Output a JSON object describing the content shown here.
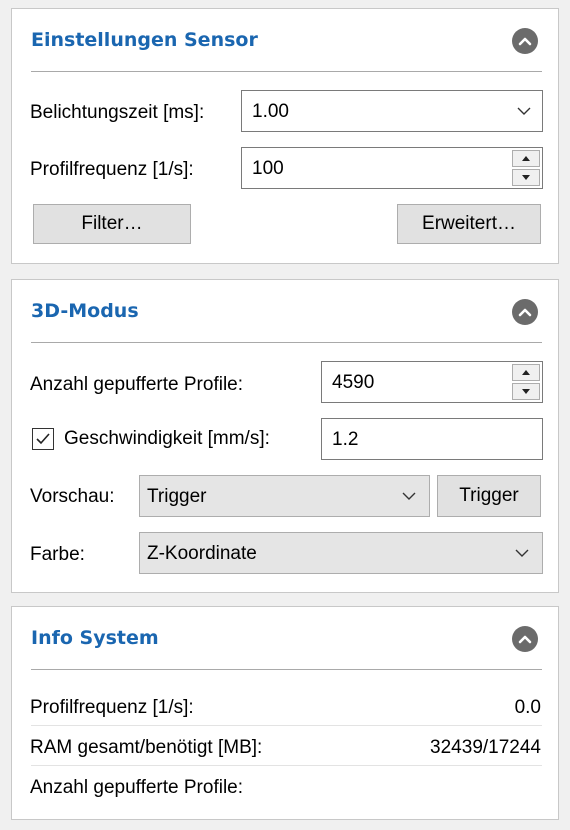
{
  "sensor": {
    "title": "Einstellungen Sensor",
    "exposure_label": "Belichtungszeit [ms]:",
    "exposure_value": "1.00",
    "profile_freq_label": "Profilfrequenz [1/s]:",
    "profile_freq_value": "100",
    "filter_button": "Filter…",
    "advanced_button": "Erweitert…"
  },
  "mode3d": {
    "title": "3D-Modus",
    "buffered_label": "Anzahl gepufferte Profile:",
    "buffered_value": "4590",
    "speed_label": "Geschwindigkeit [mm/s]:",
    "speed_checked": true,
    "speed_value": "1.2",
    "preview_label": "Vorschau:",
    "preview_value": "Trigger",
    "trigger_button": "Trigger",
    "color_label": "Farbe:",
    "color_value": "Z-Koordinate"
  },
  "info": {
    "title": "Info System",
    "rows": [
      {
        "label": "Profilfrequenz [1/s]:",
        "value": "0.0"
      },
      {
        "label": "RAM gesamt/benötigt [MB]:",
        "value": "32439/17244"
      },
      {
        "label": "Anzahl gepufferte Profile:",
        "value": ""
      }
    ]
  },
  "icons": {
    "collapse": "chevron-up-circle-icon",
    "dropdown": "chevron-down-icon",
    "spin_up": "triangle-up-icon",
    "spin_down": "triangle-down-icon",
    "check": "checkmark-icon"
  },
  "colors": {
    "title_blue": "#1a66b0",
    "panel_bg": "#ffffff",
    "window_bg": "#f0f0f0"
  }
}
